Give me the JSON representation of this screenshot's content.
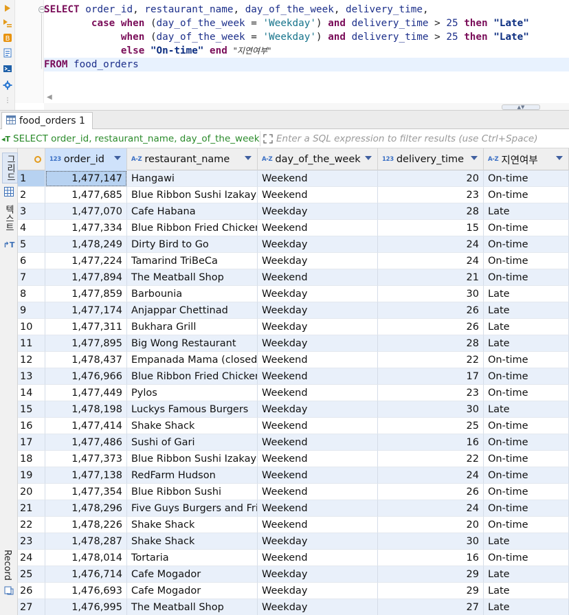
{
  "editor": {
    "lines": [
      [
        {
          "t": "SELECT ",
          "c": "kw"
        },
        {
          "t": "order_id",
          "c": "id"
        },
        {
          "t": ", ",
          "c": "plain"
        },
        {
          "t": "restaurant_name",
          "c": "id"
        },
        {
          "t": ", ",
          "c": "plain"
        },
        {
          "t": "day_of_the_week",
          "c": "id"
        },
        {
          "t": ", ",
          "c": "plain"
        },
        {
          "t": "delivery_time",
          "c": "id"
        },
        {
          "t": ",",
          "c": "plain"
        }
      ],
      [
        {
          "t": "        case when ",
          "c": "kw"
        },
        {
          "t": "(",
          "c": "plain"
        },
        {
          "t": "day_of_the_week",
          "c": "id"
        },
        {
          "t": " = ",
          "c": "plain"
        },
        {
          "t": "'Weekday'",
          "c": "str"
        },
        {
          "t": ") ",
          "c": "plain"
        },
        {
          "t": "and ",
          "c": "kw"
        },
        {
          "t": "delivery_time",
          "c": "id"
        },
        {
          "t": " > ",
          "c": "plain"
        },
        {
          "t": "25 ",
          "c": "num"
        },
        {
          "t": "then ",
          "c": "kw"
        },
        {
          "t": "\"Late\"",
          "c": "strd"
        }
      ],
      [
        {
          "t": "             when ",
          "c": "kw"
        },
        {
          "t": "(",
          "c": "plain"
        },
        {
          "t": "day_of_the_week",
          "c": "id"
        },
        {
          "t": " = ",
          "c": "plain"
        },
        {
          "t": "'Weekday'",
          "c": "str"
        },
        {
          "t": ") ",
          "c": "plain"
        },
        {
          "t": "and ",
          "c": "kw"
        },
        {
          "t": "delivery_time",
          "c": "id"
        },
        {
          "t": " > ",
          "c": "plain"
        },
        {
          "t": "25 ",
          "c": "num"
        },
        {
          "t": "then ",
          "c": "kw"
        },
        {
          "t": "\"Late\"",
          "c": "strd"
        }
      ],
      [
        {
          "t": "             else ",
          "c": "kw"
        },
        {
          "t": "\"On-time\" ",
          "c": "strd"
        },
        {
          "t": "end ",
          "c": "kw"
        },
        {
          "t": "\"지연여부\"",
          "c": "alias"
        }
      ],
      [
        {
          "t": "FROM ",
          "c": "kw"
        },
        {
          "t": "food_orders",
          "c": "id"
        }
      ]
    ],
    "fold_marker": "−"
  },
  "results_tab": {
    "label": "food_orders 1",
    "close": "×"
  },
  "filter": {
    "query_text": "SELECT order_id, restaurant_name, day_of_the_week",
    "placeholder": "Enter a SQL expression to filter results (use Ctrl+Space)"
  },
  "side_panel": {
    "grid_label": "그리드",
    "text_label": "텍스트",
    "record_label": "Record"
  },
  "columns": [
    {
      "key": "order_id",
      "label": "order_id",
      "type": "123"
    },
    {
      "key": "restaurant_name",
      "label": "restaurant_name",
      "type": "A-Z"
    },
    {
      "key": "day_of_the_week",
      "label": "day_of_the_week",
      "type": "A-Z"
    },
    {
      "key": "delivery_time",
      "label": "delivery_time",
      "type": "123"
    },
    {
      "key": "delay_flag",
      "label": "지연여부",
      "type": "A-Z"
    }
  ],
  "rows": [
    [
      "1",
      "1,477,147",
      "Hangawi",
      "Weekend",
      "20",
      "On-time"
    ],
    [
      "2",
      "1,477,685",
      "Blue Ribbon Sushi Izakaya",
      "Weekend",
      "23",
      "On-time"
    ],
    [
      "3",
      "1,477,070",
      "Cafe Habana",
      "Weekday",
      "28",
      "Late"
    ],
    [
      "4",
      "1,477,334",
      "Blue Ribbon Fried Chicken",
      "Weekend",
      "15",
      "On-time"
    ],
    [
      "5",
      "1,478,249",
      "Dirty Bird to Go",
      "Weekday",
      "24",
      "On-time"
    ],
    [
      "6",
      "1,477,224",
      "Tamarind TriBeCa",
      "Weekday",
      "24",
      "On-time"
    ],
    [
      "7",
      "1,477,894",
      "The Meatball Shop",
      "Weekend",
      "21",
      "On-time"
    ],
    [
      "8",
      "1,477,859",
      "Barbounia",
      "Weekday",
      "30",
      "Late"
    ],
    [
      "9",
      "1,477,174",
      "Anjappar Chettinad",
      "Weekday",
      "26",
      "Late"
    ],
    [
      "10",
      "1,477,311",
      "Bukhara Grill",
      "Weekday",
      "26",
      "Late"
    ],
    [
      "11",
      "1,477,895",
      "Big Wong Restaurant",
      "Weekday",
      "28",
      "Late"
    ],
    [
      "12",
      "1,478,437",
      "Empanada Mama (closed)",
      "Weekend",
      "22",
      "On-time"
    ],
    [
      "13",
      "1,476,966",
      "Blue Ribbon Fried Chicken",
      "Weekend",
      "17",
      "On-time"
    ],
    [
      "14",
      "1,477,449",
      "Pylos",
      "Weekend",
      "23",
      "On-time"
    ],
    [
      "15",
      "1,478,198",
      "Luckys Famous Burgers",
      "Weekday",
      "30",
      "Late"
    ],
    [
      "16",
      "1,477,414",
      "Shake Shack",
      "Weekend",
      "25",
      "On-time"
    ],
    [
      "17",
      "1,477,486",
      "Sushi of Gari",
      "Weekend",
      "16",
      "On-time"
    ],
    [
      "18",
      "1,477,373",
      "Blue Ribbon Sushi Izakaya",
      "Weekend",
      "22",
      "On-time"
    ],
    [
      "19",
      "1,477,138",
      "RedFarm Hudson",
      "Weekend",
      "24",
      "On-time"
    ],
    [
      "20",
      "1,477,354",
      "Blue Ribbon Sushi",
      "Weekend",
      "26",
      "On-time"
    ],
    [
      "21",
      "1,478,296",
      "Five Guys Burgers and Fries",
      "Weekend",
      "24",
      "On-time"
    ],
    [
      "22",
      "1,478,226",
      "Shake Shack",
      "Weekend",
      "20",
      "On-time"
    ],
    [
      "23",
      "1,478,287",
      "Shake Shack",
      "Weekday",
      "30",
      "Late"
    ],
    [
      "24",
      "1,478,014",
      "Tortaria",
      "Weekend",
      "16",
      "On-time"
    ],
    [
      "25",
      "1,476,714",
      "Cafe Mogador",
      "Weekday",
      "29",
      "Late"
    ],
    [
      "26",
      "1,476,693",
      "Cafe Mogador",
      "Weekday",
      "29",
      "Late"
    ],
    [
      "27",
      "1,476,995",
      "The Meatball Shop",
      "Weekday",
      "27",
      "Late"
    ]
  ],
  "colors": {
    "accent": "#3a6fc4",
    "selected_row": "#b7d2f1",
    "alt_row": "#e9f0fa",
    "keyword": "#7a0d59"
  }
}
